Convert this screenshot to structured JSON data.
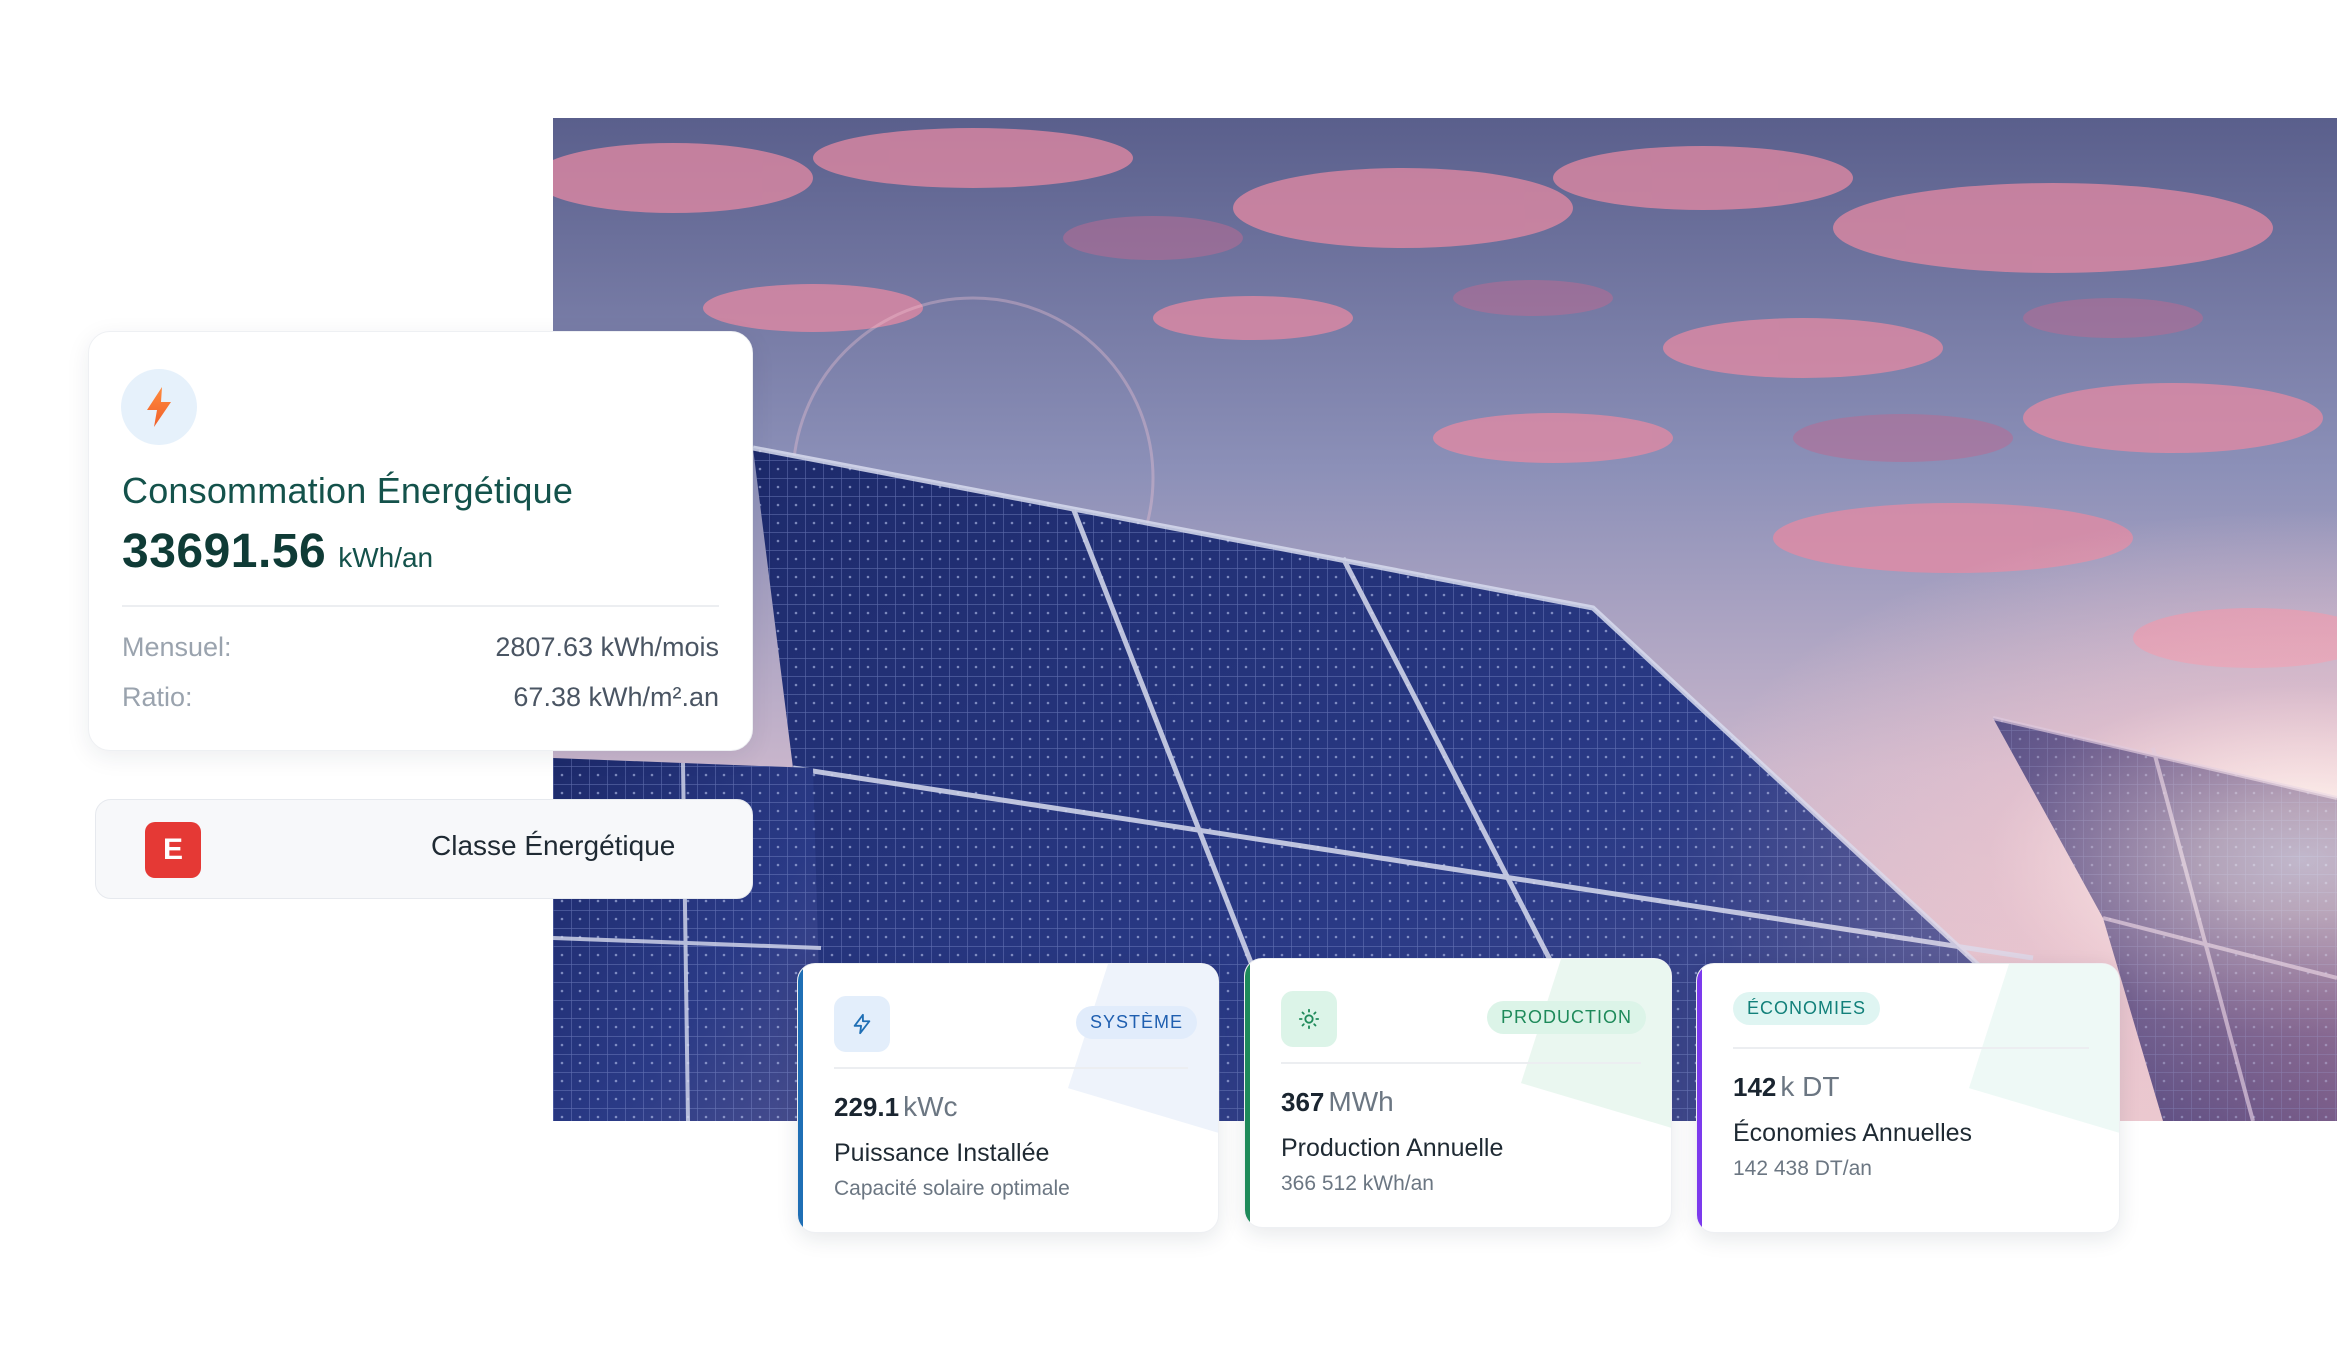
{
  "energy": {
    "title": "Consommation Énergétique",
    "value": "33691.56",
    "unit": "kWh/an",
    "monthly_label": "Mensuel:",
    "monthly_value": "2807.63 kWh/mois",
    "ratio_label": "Ratio:",
    "ratio_value": "67.38 kWh/m².an"
  },
  "energy_class": {
    "grade": "E",
    "label": "Classe Énergétique",
    "grade_color": "#e53935"
  },
  "kpis": {
    "system": {
      "tag": "SYSTÈME",
      "value": "229.1",
      "unit": "kWc",
      "label": "Puissance Installée",
      "sub": "Capacité solaire optimale",
      "accent": "#1f6fb5"
    },
    "production": {
      "tag": "PRODUCTION",
      "value": "367",
      "unit": "MWh",
      "label": "Production Annuelle",
      "sub": "366 512 kWh/an",
      "accent": "#1e8a5a"
    },
    "savings": {
      "tag": "ÉCONOMIES",
      "value": "142",
      "unit": "k DT",
      "label": "Économies Annuelles",
      "sub": "142 438 DT/an",
      "accent": "#7c3aed"
    }
  },
  "icons": {
    "energy": "bolt-icon",
    "system": "bolt-outline-icon",
    "production": "sun-icon"
  }
}
